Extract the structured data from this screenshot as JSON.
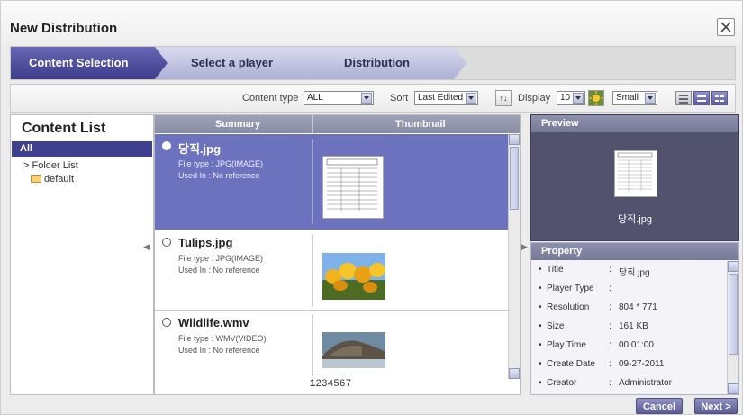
{
  "dialog": {
    "title": "New Distribution"
  },
  "steps": [
    {
      "label": "Content Selection",
      "active": true
    },
    {
      "label": "Select a player",
      "active": false
    },
    {
      "label": "Distribution",
      "active": false
    }
  ],
  "filters": {
    "content_type_label": "Content type",
    "content_type_value": "ALL",
    "sort_label": "Sort",
    "sort_value": "Last Edited",
    "display_label": "Display",
    "display_value": "10",
    "size_value": "Small"
  },
  "content_list": {
    "title": "Content List",
    "all_label": "All",
    "folder_label": "> Folder List",
    "default_folder": "default"
  },
  "table": {
    "col_summary": "Summary",
    "col_thumbnail": "Thumbnail",
    "rows": [
      {
        "name": "당직.jpg",
        "file_type": "File type : JPG(IMAGE)",
        "used_in": "Used In : No reference",
        "selected": true,
        "thumb_icon": "document-thumbnail"
      },
      {
        "name": "Tulips.jpg",
        "file_type": "File type : JPG(IMAGE)",
        "used_in": "Used In : No reference",
        "selected": false,
        "thumb_icon": "tulips-thumbnail"
      },
      {
        "name": "Wildlife.wmv",
        "file_type": "File type : WMV(VIDEO)",
        "used_in": "Used In : No reference",
        "selected": false,
        "thumb_icon": "wildlife-thumbnail"
      }
    ],
    "pager_current": "1",
    "pager_rest": "234567"
  },
  "preview": {
    "heading": "Preview",
    "name": "당직.jpg"
  },
  "property": {
    "heading": "Property",
    "rows": [
      {
        "key": "Title",
        "value": "당직.jpg"
      },
      {
        "key": "Player Type",
        "value": ""
      },
      {
        "key": "Resolution",
        "value": "804 * 771"
      },
      {
        "key": "Size",
        "value": "161 KB"
      },
      {
        "key": "Play Time",
        "value": "00:01:00"
      },
      {
        "key": "Create Date",
        "value": "09-27-2011"
      },
      {
        "key": "Creator",
        "value": "Administrator"
      }
    ]
  },
  "buttons": {
    "cancel": "Cancel",
    "next": "Next >"
  },
  "colors": {
    "accent": "#3f3f8f",
    "selected_row": "#6c72bd",
    "step_active": "#4a4a9c",
    "preview_bg": "#52526e"
  }
}
